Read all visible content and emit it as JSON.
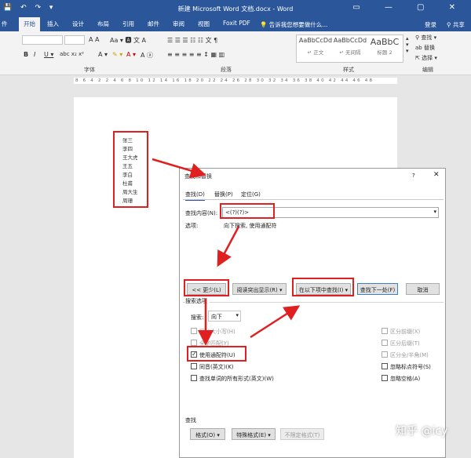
{
  "window": {
    "title": "新建 Microsoft Word 文档.docx - Word",
    "login": "登录",
    "share": "共享"
  },
  "tabs": [
    "开始",
    "插入",
    "设计",
    "布局",
    "引用",
    "邮件",
    "审阅",
    "视图",
    "Foxit PDF"
  ],
  "tell_me": "告诉我您想要做什么...",
  "ribbon": {
    "font_label": "字体",
    "paragraph_label": "段落",
    "styles_label": "样式",
    "editing_label": "编辑",
    "styles": [
      {
        "preview": "AaBbCcDd",
        "name": "↵ 正文"
      },
      {
        "preview": "AaBbCcDd",
        "name": "↵ 无间隔"
      },
      {
        "preview": "AaBbC",
        "name": "标题 2"
      }
    ],
    "find": "查找",
    "replace": "替换",
    "select": "选择"
  },
  "ruler_text": "8 6 4 2 2 4 6 8 10 12 14 16 18 20 22 24 26 28 30 32 34 36 38 40 42 44 46 48",
  "names": [
    "张三",
    "李四",
    "王大虎",
    "王五",
    "李白",
    "杜甫",
    "周大生",
    "周珊"
  ],
  "dialog": {
    "title": "查找和替换",
    "help": "?",
    "close": "✕",
    "tabs": [
      "查找(D)",
      "替换(P)",
      "定位(G)"
    ],
    "find_label": "查找内容(N):",
    "find_value": "<(?)(?)>",
    "options_label": "选项:",
    "options_value": "向下搜索, 使用通配符",
    "less_btn": "<< 更少(L)",
    "reading_btn": "阅读突出显示(R) ▾",
    "findin_btn": "在以下项中查找(I) ▾",
    "findnext_btn": "查找下一处(F)",
    "cancel_btn": "取消",
    "search_options_label": "搜索选项",
    "search_label": "搜索:",
    "search_value": "向下",
    "left_checks": [
      {
        "label": "区分大小写(H)",
        "checked": false,
        "disabled": true
      },
      {
        "label": "全字匹配(Y)",
        "checked": false,
        "disabled": true
      },
      {
        "label": "使用通配符(U)",
        "checked": true,
        "disabled": false
      },
      {
        "label": "同音(英文)(K)",
        "checked": false,
        "disabled": false
      },
      {
        "label": "查找单词的所有形式(英文)(W)",
        "checked": false,
        "disabled": false
      }
    ],
    "right_checks": [
      {
        "label": "区分前缀(X)",
        "checked": false,
        "disabled": true
      },
      {
        "label": "区分后缀(T)",
        "checked": false,
        "disabled": true
      },
      {
        "label": "区分全/半角(M)",
        "checked": false,
        "disabled": true
      },
      {
        "label": "忽略标点符号(S)",
        "checked": false,
        "disabled": false
      },
      {
        "label": "忽略空格(A)",
        "checked": false,
        "disabled": false
      }
    ],
    "find_section_label": "查找",
    "format_btn": "格式(O) ▾",
    "special_btn": "特殊格式(E) ▾",
    "noformat_btn": "不限定格式(T)"
  },
  "watermark": "知乎 @icy",
  "colors": {
    "title_bg": "#2b579a",
    "highlight": "#e02020"
  }
}
